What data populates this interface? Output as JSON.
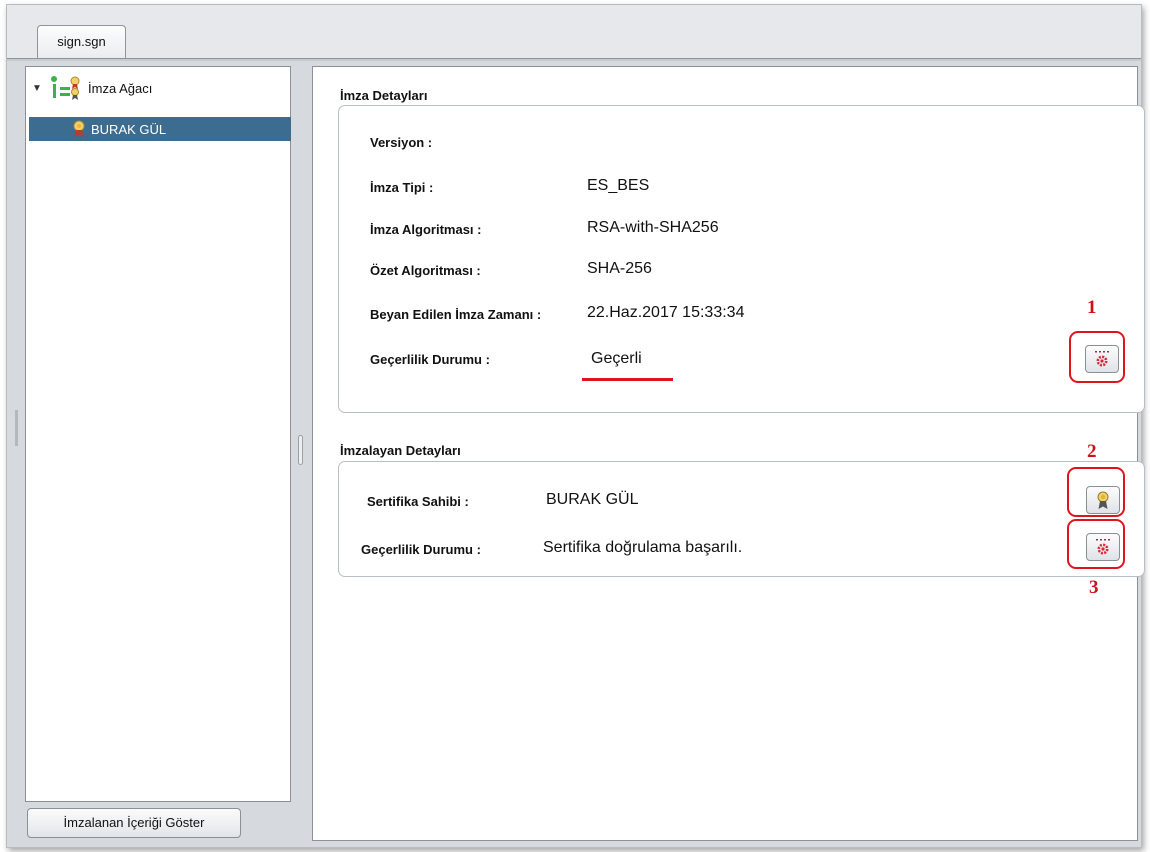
{
  "tab": {
    "label": "sign.sgn"
  },
  "tree": {
    "toggle_glyph": "▼",
    "root_label": "İmza Ağacı",
    "child_label": "BURAK GÜL"
  },
  "left_button": {
    "label": "İmzalanan İçeriği Göster"
  },
  "signature_details": {
    "title": "İmza Detayları",
    "rows": [
      {
        "label": "Versiyon :",
        "value": ""
      },
      {
        "label": "İmza Tipi :",
        "value": "ES_BES"
      },
      {
        "label": "İmza Algoritması :",
        "value": "RSA-with-SHA256"
      },
      {
        "label": "Özet Algoritması :",
        "value": "SHA-256"
      },
      {
        "label": "Beyan Edilen İmza Zamanı :",
        "value": "22.Haz.2017 15:33:34"
      },
      {
        "label": "Geçerlilik Durumu :",
        "value": "Geçerli"
      }
    ]
  },
  "signer_details": {
    "title": "İmzalayan Detayları",
    "rows": [
      {
        "label": "Sertifika Sahibi :",
        "value": "BURAK GÜL"
      },
      {
        "label": "Geçerlilik Durumu :",
        "value": "Sertifika doğrulama başarılı."
      }
    ]
  },
  "annotations": {
    "n1": "1",
    "n2": "2",
    "n3": "3"
  },
  "icons": {
    "validate": "gear-check-icon",
    "certificate": "certificate-ribbon-icon",
    "tree_root": "signature-tree-icon"
  },
  "colors": {
    "selection": "#3d6c91",
    "annotation_red": "#e0141e",
    "gear": "#d8263a"
  }
}
